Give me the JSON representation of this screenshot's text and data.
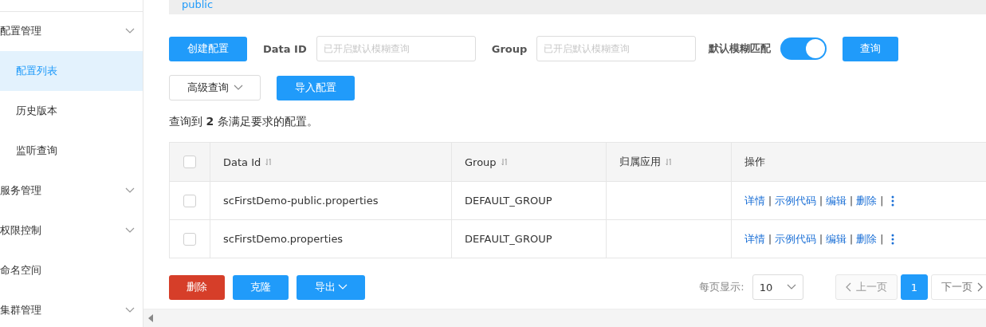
{
  "sidebar": {
    "items": [
      {
        "label": "配置管理",
        "kind": "group",
        "expanded": true,
        "children": [
          {
            "label": "配置列表",
            "selected": true
          },
          {
            "label": "历史版本",
            "selected": false
          },
          {
            "label": "监听查询",
            "selected": false
          }
        ]
      },
      {
        "label": "服务管理",
        "kind": "group"
      },
      {
        "label": "权限控制",
        "kind": "group"
      },
      {
        "label": "命名空间",
        "kind": "link"
      },
      {
        "label": "集群管理",
        "kind": "group"
      }
    ]
  },
  "namespace_bar": {
    "label": "public"
  },
  "toolbar": {
    "create_button": "创建配置",
    "data_id": {
      "label": "Data ID",
      "placeholder": "已开启默认模糊查询"
    },
    "group": {
      "label": "Group",
      "placeholder": "已开启默认模糊查询"
    },
    "fuzzy": {
      "label": "默认模糊匹配",
      "on": true
    },
    "search_button": "查询",
    "advanced_button": "高级查询",
    "import_button": "导入配置"
  },
  "summary": "查询到 **2** 条满足要求的配置。",
  "table": {
    "select_all_checked": false,
    "columns": [
      {
        "label": "Data Id",
        "sortable": true
      },
      {
        "label": "Group",
        "sortable": true
      },
      {
        "label": "归属应用",
        "sortable": true
      },
      {
        "label": "操作"
      }
    ],
    "action_separator": "|",
    "rows": [
      {
        "checked": false,
        "data_id": "scFirstDemo-public.properties",
        "group": "DEFAULT_GROUP",
        "actions": [
          "详情",
          "示例代码",
          "编辑",
          "删除"
        ]
      },
      {
        "checked": false,
        "data_id": "scFirstDemo.properties",
        "group": "DEFAULT_GROUP",
        "actions": [
          "详情",
          "示例代码",
          "编辑",
          "删除"
        ]
      }
    ]
  },
  "footer": {
    "delete_button": "删除",
    "clone_button": "克隆",
    "export_button": "导出",
    "page_size_label": "每页显示:",
    "page_size": "10",
    "prev": {
      "label": "上一页",
      "disabled": true
    },
    "pages": [
      {
        "label": "1",
        "selected": true
      }
    ],
    "next": {
      "label": "下一页",
      "disabled": false
    }
  }
}
